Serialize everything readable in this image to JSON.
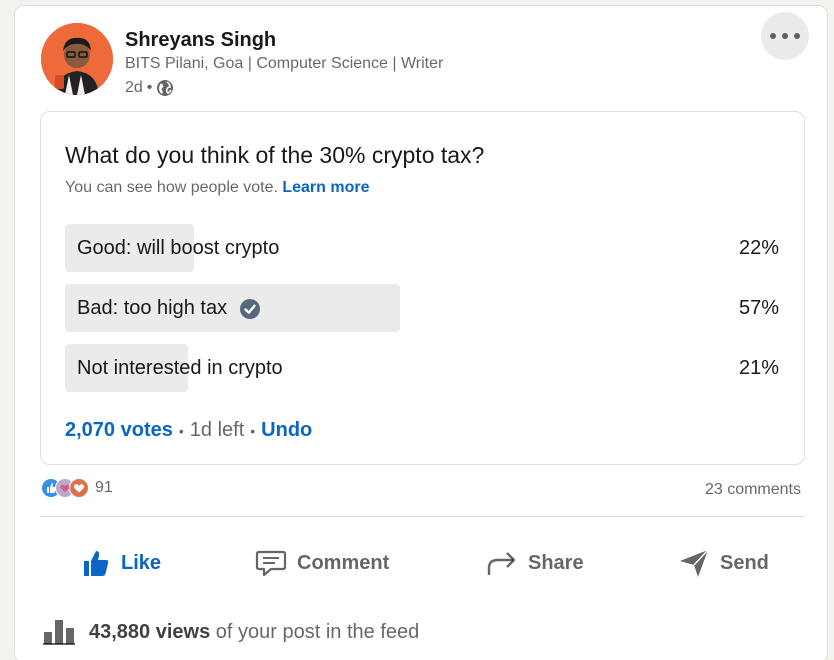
{
  "post": {
    "author": {
      "name": "Shreyans Singh",
      "headline": "BITS Pilani, Goa | Computer Science | Writer",
      "time": "2d",
      "separator": "•"
    },
    "more_icon": "ellipsis-icon"
  },
  "poll": {
    "question": "What do you think of the 30% crypto tax?",
    "subtitle": "You can see how people vote.",
    "learn_more": "Learn more",
    "options": [
      {
        "label": "Good: will boost crypto",
        "percent": "22%",
        "share": 0.22,
        "selected": false
      },
      {
        "label": "Bad: too high tax",
        "percent": "57%",
        "share": 0.57,
        "selected": true
      },
      {
        "label": "Not interested in crypto",
        "percent": "21%",
        "share": 0.21,
        "selected": false
      }
    ],
    "votes": "2,070 votes",
    "time_left": "1d left",
    "undo": "Undo",
    "dot": "•"
  },
  "social": {
    "reaction_count": "91",
    "comments": "23 comments"
  },
  "actions": {
    "like": "Like",
    "comment": "Comment",
    "share": "Share",
    "send": "Send"
  },
  "views": {
    "count": "43,880 views",
    "suffix": "of your post in the feed"
  },
  "colors": {
    "link_blue": "#0a66c2",
    "poll_fill": "#ebebeb",
    "avatar_bg": "#ee6a3a"
  }
}
